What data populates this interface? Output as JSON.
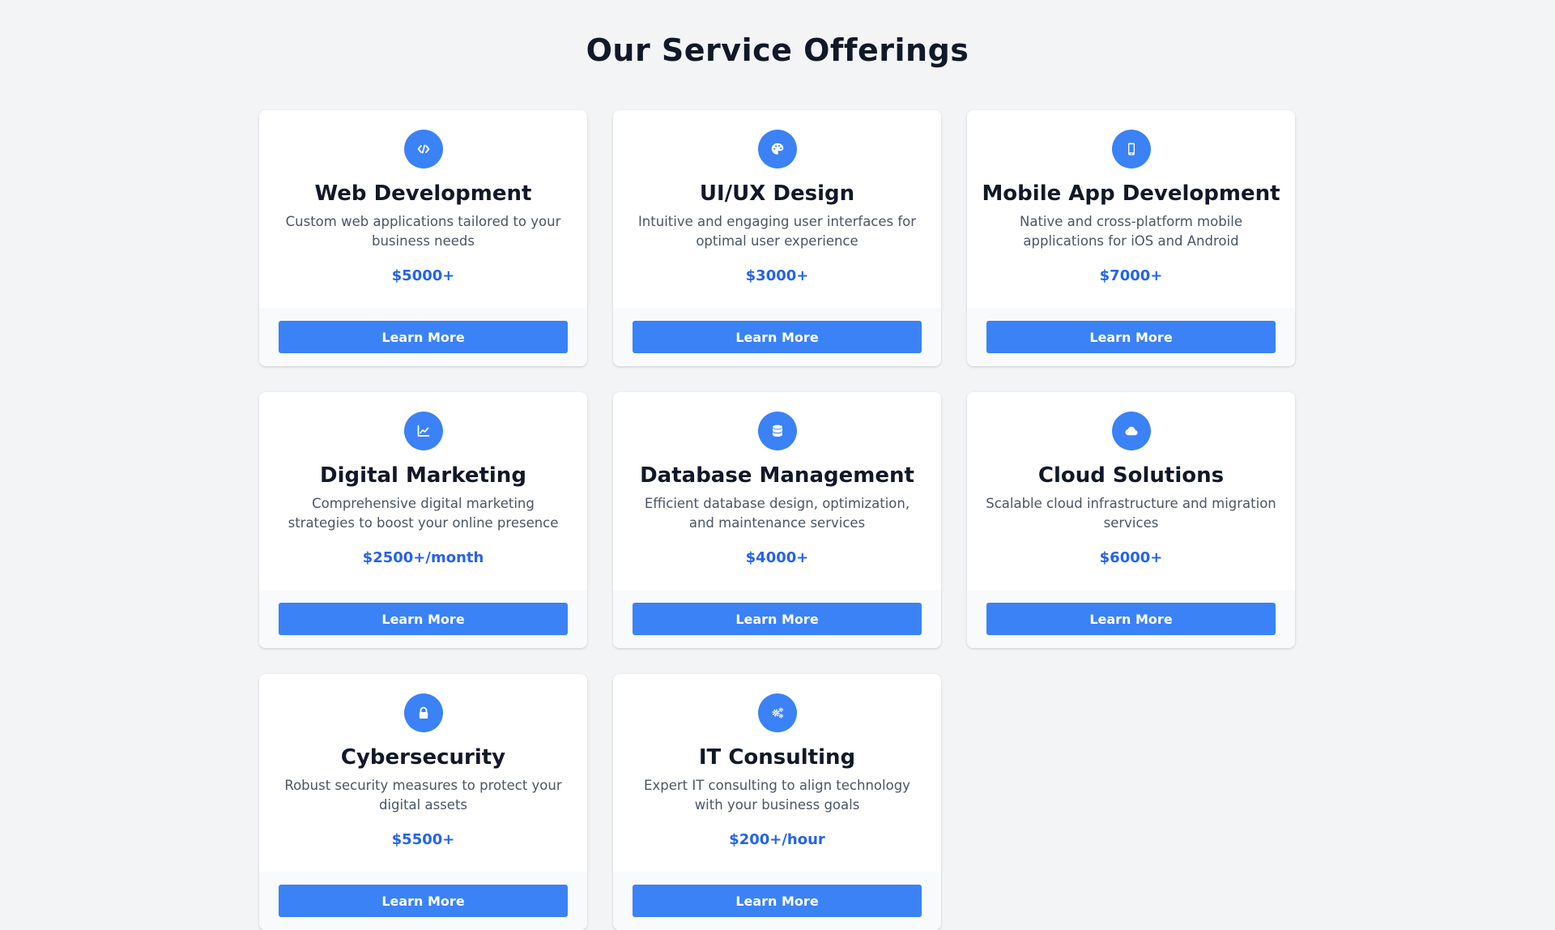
{
  "page": {
    "title": "Our Service Offerings"
  },
  "theme": {
    "accent": "#3b82f6",
    "price_color": "#2563eb",
    "background": "#f3f4f6"
  },
  "services": [
    {
      "icon": "code-icon",
      "title": "Web Development",
      "description": "Custom web applications tailored to your business needs",
      "price": "$5000+",
      "button": "Learn More"
    },
    {
      "icon": "palette-icon",
      "title": "UI/UX Design",
      "description": "Intuitive and engaging user interfaces for optimal user experience",
      "price": "$3000+",
      "button": "Learn More"
    },
    {
      "icon": "mobile-phone-icon",
      "title": "Mobile App Development",
      "description": "Native and cross-platform mobile applications for iOS and Android",
      "price": "$7000+",
      "button": "Learn More"
    },
    {
      "icon": "chart-line-icon",
      "title": "Digital Marketing",
      "description": "Comprehensive digital marketing strategies to boost your online presence",
      "price": "$2500+/month",
      "button": "Learn More"
    },
    {
      "icon": "database-icon",
      "title": "Database Management",
      "description": "Efficient database design, optimization, and maintenance services",
      "price": "$4000+",
      "button": "Learn More"
    },
    {
      "icon": "cloud-icon",
      "title": "Cloud Solutions",
      "description": "Scalable cloud infrastructure and migration services",
      "price": "$6000+",
      "button": "Learn More"
    },
    {
      "icon": "lock-icon",
      "title": "Cybersecurity",
      "description": "Robust security measures to protect your digital assets",
      "price": "$5500+",
      "button": "Learn More"
    },
    {
      "icon": "gears-icon",
      "title": "IT Consulting",
      "description": "Expert IT consulting to align technology with your business goals",
      "price": "$200+/hour",
      "button": "Learn More"
    }
  ]
}
